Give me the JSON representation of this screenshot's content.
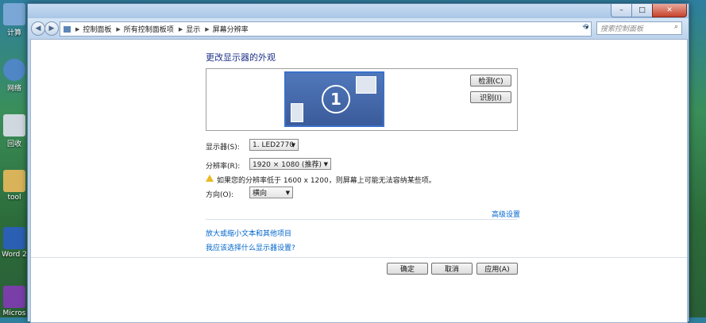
{
  "desktop": {
    "icons": [
      {
        "label": "计算",
        "name": "computer"
      },
      {
        "label": "网络",
        "name": "network"
      },
      {
        "label": "回收",
        "name": "recycle"
      },
      {
        "label": "tool",
        "name": "tools"
      },
      {
        "label": "Word 2",
        "name": "word"
      },
      {
        "label": "Micros",
        "name": "visual-studio"
      }
    ]
  },
  "window": {
    "caption": {
      "minimize": "–",
      "maximize": "□",
      "close": "✕"
    },
    "nav": {
      "back": "◀",
      "forward": "▶"
    },
    "breadcrumb": [
      "控制面板",
      "所有控制面板项",
      "显示",
      "屏幕分辨率"
    ],
    "address_dropdown": "▾",
    "refresh_icon": "⟲",
    "search": {
      "placeholder": "搜索控制面板",
      "icon": "⌕"
    }
  },
  "main": {
    "title": "更改显示器的外观",
    "monitor_number": "1",
    "detect_button": "检测(C)",
    "identify_button": "识别(I)",
    "display_label": "显示器(S):",
    "display_value": "1. LED2770",
    "resolution_label": "分辨率(R):",
    "resolution_value": "1920 × 1080 (推荐)",
    "warning_text": "如果您的分辨率低于 1600 x 1200，则屏幕上可能无法容纳某些项。",
    "orientation_label": "方向(O):",
    "orientation_value": "横向",
    "advanced_link": "高级设置",
    "link1": "放大或缩小文本和其他项目",
    "link2": "我应该选择什么显示器设置?",
    "ok_button": "确定",
    "cancel_button": "取消",
    "apply_button": "应用(A)"
  }
}
